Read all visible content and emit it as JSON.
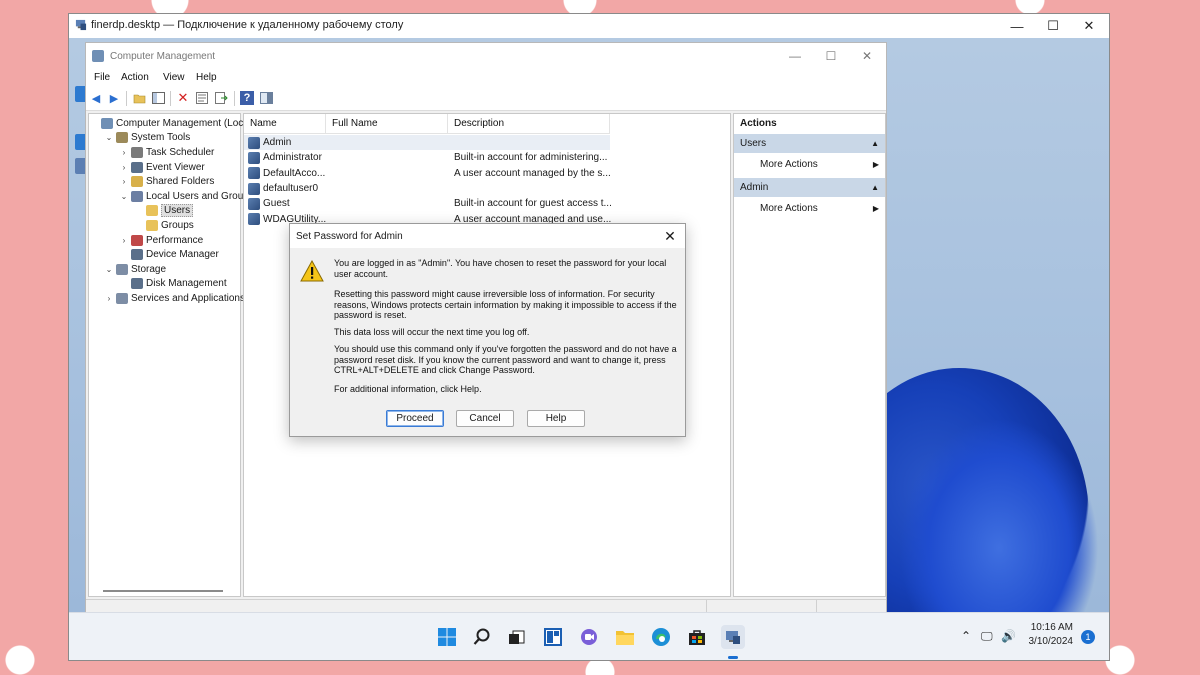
{
  "rdp": {
    "title": "finerdp.desktp — Подключение к удаленному рабочему столу",
    "minimize_glyph": "—",
    "maximize_glyph": "☐",
    "close_glyph": "✕"
  },
  "window": {
    "title": "Computer Management",
    "minimize_glyph": "—",
    "maximize_glyph": "☐",
    "close_glyph": "✕"
  },
  "menu": [
    "File",
    "Action",
    "View",
    "Help"
  ],
  "tree": [
    {
      "label": "Computer Management (Local",
      "level": 0,
      "expander": "",
      "icon_color": "#6f8fb5"
    },
    {
      "label": "System Tools",
      "level": 1,
      "expander": "⌄",
      "icon_color": "#9c8a5a"
    },
    {
      "label": "Task Scheduler",
      "level": 2,
      "expander": "›",
      "icon_color": "#7a7a7a"
    },
    {
      "label": "Event Viewer",
      "level": 2,
      "expander": "›",
      "icon_color": "#5a6f8a"
    },
    {
      "label": "Shared Folders",
      "level": 2,
      "expander": "›",
      "icon_color": "#d8b04a"
    },
    {
      "label": "Local Users and Groups",
      "level": 2,
      "expander": "⌄",
      "icon_color": "#6c7fa3"
    },
    {
      "label": "Users",
      "level": 3,
      "expander": "",
      "icon_color": "#e8c25a",
      "selected": true
    },
    {
      "label": "Groups",
      "level": 3,
      "expander": "",
      "icon_color": "#e8c25a"
    },
    {
      "label": "Performance",
      "level": 2,
      "expander": "›",
      "icon_color": "#c04848"
    },
    {
      "label": "Device Manager",
      "level": 2,
      "expander": "",
      "icon_color": "#5a6f8a"
    },
    {
      "label": "Storage",
      "level": 1,
      "expander": "⌄",
      "icon_color": "#7d8da5"
    },
    {
      "label": "Disk Management",
      "level": 2,
      "expander": "",
      "icon_color": "#5a6f8a"
    },
    {
      "label": "Services and Applications",
      "level": 1,
      "expander": "›",
      "icon_color": "#7d8da5"
    }
  ],
  "list": {
    "columns": [
      "Name",
      "Full Name",
      "Description"
    ],
    "rows": [
      {
        "name": "Admin",
        "full_name": "",
        "description": ""
      },
      {
        "name": "Administrator",
        "full_name": "",
        "description": "Built-in account for administering..."
      },
      {
        "name": "DefaultAcco...",
        "full_name": "",
        "description": "A user account managed by the s..."
      },
      {
        "name": "defaultuser0",
        "full_name": "",
        "description": ""
      },
      {
        "name": "Guest",
        "full_name": "",
        "description": "Built-in account for guest access t..."
      },
      {
        "name": "WDAGUtility...",
        "full_name": "",
        "description": "A user account managed and use..."
      }
    ]
  },
  "actions": {
    "header": "Actions",
    "sections": [
      {
        "title": "Users",
        "item": "More Actions"
      },
      {
        "title": "Admin",
        "item": "More Actions"
      }
    ]
  },
  "dialog": {
    "title": "Set Password for Admin",
    "close_glyph": "✕",
    "paragraphs": [
      "You are logged in as \"Admin\". You have chosen to reset the password for your local user account.",
      "Resetting this password might cause irreversible loss of information. For security reasons, Windows protects certain information by making it impossible to access if the password is reset.",
      "This data loss will occur the next time you log off.",
      "You should use this command only if you've forgotten the password and do not have a password reset disk. If you know the current password and want to change it, press CTRL+ALT+DELETE and click Change Password.",
      "For additional information, click Help."
    ],
    "buttons": [
      "Proceed",
      "Cancel",
      "Help"
    ]
  },
  "taskbar": {
    "time": "10:16 AM",
    "date": "3/10/2024",
    "notification_count": "1",
    "icons": [
      "start-icon",
      "search-icon",
      "task-view-icon",
      "widgets-icon",
      "chat-icon",
      "file-explorer-icon",
      "edge-icon",
      "store-icon",
      "computer-management-icon"
    ]
  },
  "colors": {
    "accent": "#1a6fd1",
    "actions_section": "#c9d7e7"
  }
}
